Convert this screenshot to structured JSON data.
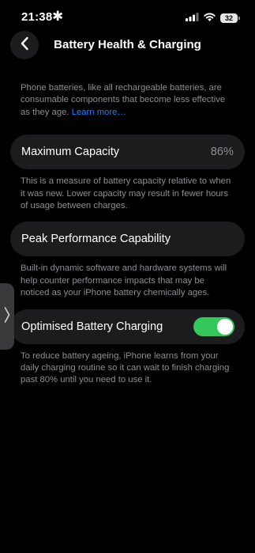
{
  "status_bar": {
    "time": "21:38",
    "battery_level": "32",
    "icons": [
      "bluetooth-asterisk-icon",
      "cellular-signal-icon",
      "wifi-icon",
      "battery-icon"
    ]
  },
  "nav": {
    "title": "Battery Health & Charging",
    "back_icon": "chevron-left-icon"
  },
  "intro": {
    "text": "Phone batteries, like all rechargeable batteries, are consumable components that become less effective as they age. ",
    "link_label": "Learn more…"
  },
  "maximum_capacity": {
    "label": "Maximum Capacity",
    "value": "86%",
    "footnote": "This is a measure of battery capacity relative to when it was new. Lower capacity may result in fewer hours of usage between charges."
  },
  "peak_performance": {
    "label": "Peak Performance Capability",
    "footnote": "Built-in dynamic software and hardware systems will help counter performance impacts that may be noticed as your iPhone battery chemically ages."
  },
  "optimised_charging": {
    "label": "Optimised Battery Charging",
    "enabled": true,
    "footnote": "To reduce battery ageing, iPhone learns from your daily charging routine so it can wait to finish charging past 80% until you need to use it."
  },
  "side_handle": {
    "icon": "chevron-right-icon"
  },
  "colors": {
    "background": "#000000",
    "card": "#1c1c1e",
    "secondary_text": "#8e8e93",
    "link": "#0a84ff",
    "toggle_on": "#34c759"
  }
}
